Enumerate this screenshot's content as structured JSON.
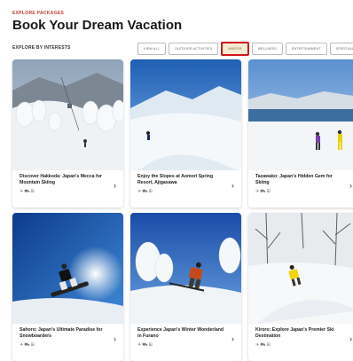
{
  "header": {
    "eyebrow": "EXPLORE PACKAGES",
    "title": "Book Your Dream Vacation"
  },
  "filters": {
    "label": "EXPLORE BY INTERESTS",
    "chips": [
      {
        "label": "VIEW ALL",
        "active": false
      },
      {
        "label": "OUTDOOR ACTIVITIES",
        "active": false
      },
      {
        "label": "WINTER",
        "active": true
      },
      {
        "label": "WELLNESS",
        "active": false
      },
      {
        "label": "ENTERTAINMENT",
        "active": false
      },
      {
        "label": "SPIRITUAL",
        "active": false
      }
    ]
  },
  "cards": [
    {
      "title": "Discover Hakkoda: Japan's Mecca for Mountain Skiing",
      "icons": "✈⛟⊞"
    },
    {
      "title": "Enjoy the Slopes at Aomori Spring Resort, Ajigasawa",
      "icons": "✈⛟⊞"
    },
    {
      "title": "Tazawako: Japan's Hidden Gem for Skiing",
      "icons": "✈⛟⊞"
    },
    {
      "title": "Sahoro: Japan's Ultimate Paradise for Snowboarders",
      "icons": "✈⛟⊞"
    },
    {
      "title": "Experience Japan's Winter Wonderland in Furano",
      "icons": "✈⛟⊞"
    },
    {
      "title": "Kiroro: Explore Japan's Premier Ski Destination",
      "icons": "✈⛟⊞"
    }
  ],
  "icons": {
    "card_chevron": "chevron-right-icon",
    "card_info": "travel-icons"
  },
  "colors": {
    "accent": "#c0392b",
    "active_chip_border": "#d0141a",
    "active_chip_bg": "#f4ecd2"
  }
}
